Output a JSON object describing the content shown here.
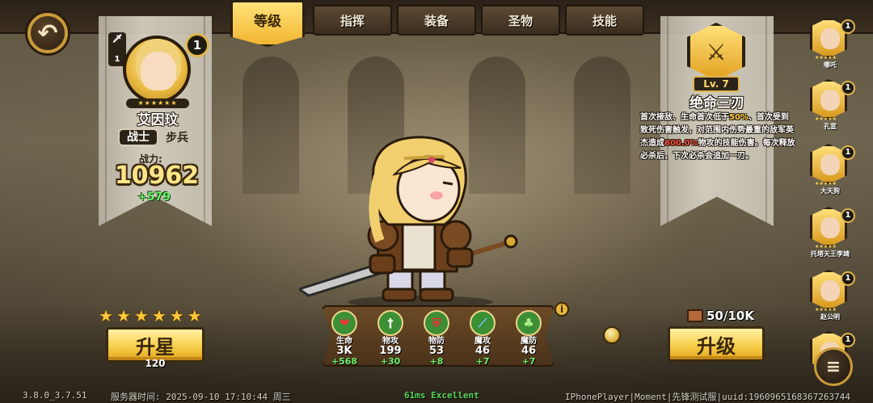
{
  "tabs": [
    {
      "label": "等级",
      "active": true
    },
    {
      "label": "指挥",
      "active": false
    },
    {
      "label": "装备",
      "active": false
    },
    {
      "label": "圣物",
      "active": false
    },
    {
      "label": "技能",
      "active": false
    }
  ],
  "hero": {
    "name": "艾因玟",
    "class_label": "战士",
    "type_label": "步兵",
    "level": "1",
    "rank_top": "1",
    "rank_bottom": "1",
    "power_label": "战力:",
    "power_value": "10962",
    "power_delta": "+579",
    "star_count": 6
  },
  "star_up": {
    "label": "升星",
    "cost": "120"
  },
  "stats": [
    {
      "name": "生命",
      "value": "3K",
      "delta": "+568",
      "icon": "heart-icon",
      "color": "#3c8f34"
    },
    {
      "name": "物攻",
      "value": "199",
      "delta": "+30",
      "icon": "sword-icon",
      "color": "#3c8f34"
    },
    {
      "name": "物防",
      "value": "53",
      "delta": "+8",
      "icon": "shield-icon",
      "color": "#3c8f34"
    },
    {
      "name": "魔攻",
      "value": "46",
      "delta": "+7",
      "icon": "wand-icon",
      "color": "#3c8f34"
    },
    {
      "name": "魔防",
      "value": "46",
      "delta": "+7",
      "icon": "clover-icon",
      "color": "#3c8f34"
    }
  ],
  "skill": {
    "level": "Lv. 7",
    "name": "绝命三刃",
    "desc_1": "首次接敌、生命首次低于",
    "desc_hl_1": "50%",
    "desc_2": "、首次受到致死伤害触发，对范围内伤势最重的敌军英杰造成",
    "desc_hl_2": "600.0%",
    "desc_3": "物攻的技能伤害。每次释放必杀后，下次必杀会追加一刃。"
  },
  "upgrade": {
    "cost": "50/10K",
    "label": "升级"
  },
  "hero_list": [
    {
      "name": "哪吒",
      "level": "1"
    },
    {
      "name": "孔宣",
      "level": "1"
    },
    {
      "name": "大天狗",
      "level": "1"
    },
    {
      "name": "托塔天王李靖",
      "level": "1"
    },
    {
      "name": "赵公明",
      "level": "1"
    },
    {
      "name": "",
      "level": "1"
    }
  ],
  "footer": {
    "version": "3.8.0_3.7.51",
    "server_time": "服务器时间:  2025-09-10 17:10:44 周三",
    "fps": "61ms Excellent",
    "device": "IPhonePlayer|Moment|先锋测试服|uuid:1960965168367263744"
  },
  "colors": {
    "gold_button": "#f7cf4c",
    "power_text": "#ffe487",
    "positive_delta": "#6ef06e",
    "highlight_yellow": "#ffd23a",
    "highlight_red": "#ff4d3a"
  }
}
